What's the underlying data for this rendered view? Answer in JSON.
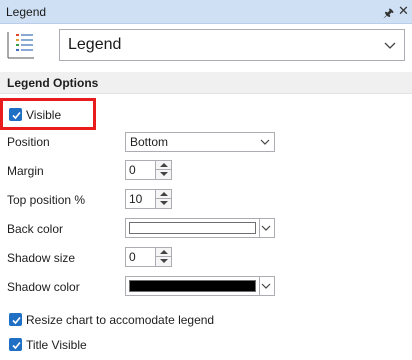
{
  "panel": {
    "title": "Legend",
    "pin_icon": "pin-icon",
    "close_icon": "close-icon"
  },
  "component_selector": {
    "icon": "legend-list-icon",
    "value": "Legend"
  },
  "section": {
    "title": "Legend Options"
  },
  "options": {
    "visible": {
      "label": "Visible",
      "checked": true
    },
    "position": {
      "label": "Position",
      "value": "Bottom"
    },
    "margin": {
      "label": "Margin",
      "value": "0"
    },
    "top_position": {
      "label": "Top position %",
      "value": "10"
    },
    "back_color": {
      "label": "Back color",
      "color": "#ffffff"
    },
    "shadow_size": {
      "label": "Shadow size",
      "value": "0"
    },
    "shadow_color": {
      "label": "Shadow color",
      "color": "#000000"
    },
    "resize_chart": {
      "label": "Resize chart to accomodate legend",
      "checked": true
    },
    "title_visible": {
      "label": "Title Visible",
      "checked": true
    }
  },
  "colors": {
    "titlebar": "#cfe0f4",
    "checkbox_accent": "#1f6fc5",
    "highlight": "#e81c1c"
  }
}
